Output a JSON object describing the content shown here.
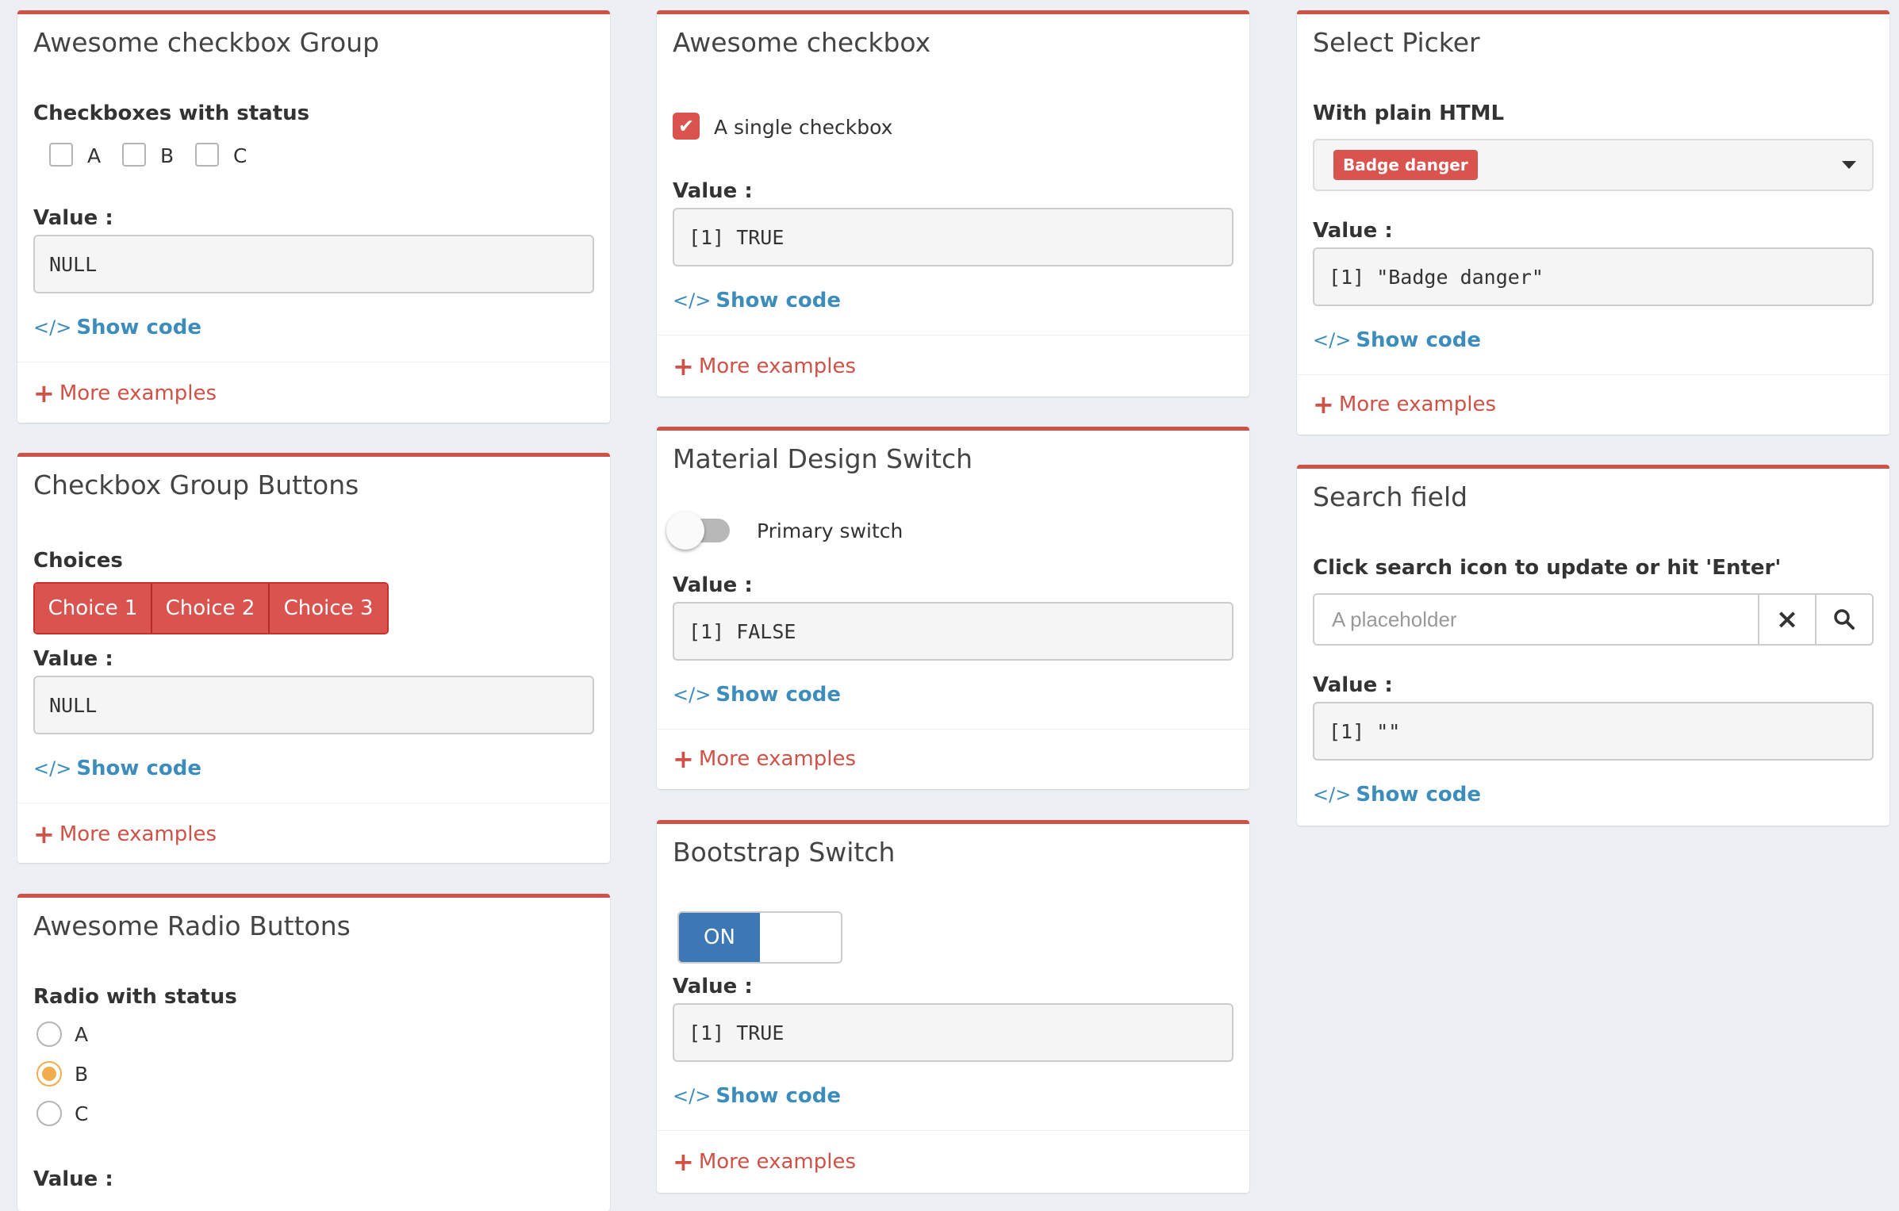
{
  "common": {
    "value_label": "Value :",
    "show_code": "Show code",
    "more_examples": "More examples",
    "code_glyph": "</>",
    "plus_glyph": "+"
  },
  "colors": {
    "accent_red": "#d05247",
    "link_blue": "#3c8dbc",
    "radio_orange": "#f0ad4e",
    "switch_blue": "#3c78b4",
    "background": "#ecf0f5"
  },
  "awesome_checkbox_group": {
    "title": "Awesome checkbox Group",
    "label": "Checkboxes with status",
    "options": [
      "A",
      "B",
      "C"
    ],
    "value": "NULL"
  },
  "checkbox_group_buttons": {
    "title": "Checkbox Group Buttons",
    "label": "Choices",
    "choices": [
      "Choice 1",
      "Choice 2",
      "Choice 3"
    ],
    "value": "NULL"
  },
  "awesome_radio_buttons": {
    "title": "Awesome Radio Buttons",
    "label": "Radio with status",
    "options": [
      "A",
      "B",
      "C"
    ],
    "selected": "B"
  },
  "awesome_checkbox": {
    "title": "Awesome checkbox",
    "checkbox_label": "A single checkbox",
    "checked": true,
    "value": "[1] TRUE"
  },
  "material_switch": {
    "title": "Material Design Switch",
    "switch_label": "Primary switch",
    "on": false,
    "value": "[1] FALSE"
  },
  "bootstrap_switch": {
    "title": "Bootstrap Switch",
    "on_label": "ON",
    "value": "[1] TRUE"
  },
  "select_picker": {
    "title": "Select Picker",
    "label": "With plain HTML",
    "selected_badge": "Badge danger",
    "value": "[1] \"Badge danger\""
  },
  "search_field": {
    "title": "Search field",
    "label": "Click search icon to update or hit 'Enter'",
    "placeholder": "A placeholder",
    "clear_icon": "×",
    "search_icon": "⌕",
    "value": "[1] \"\""
  }
}
